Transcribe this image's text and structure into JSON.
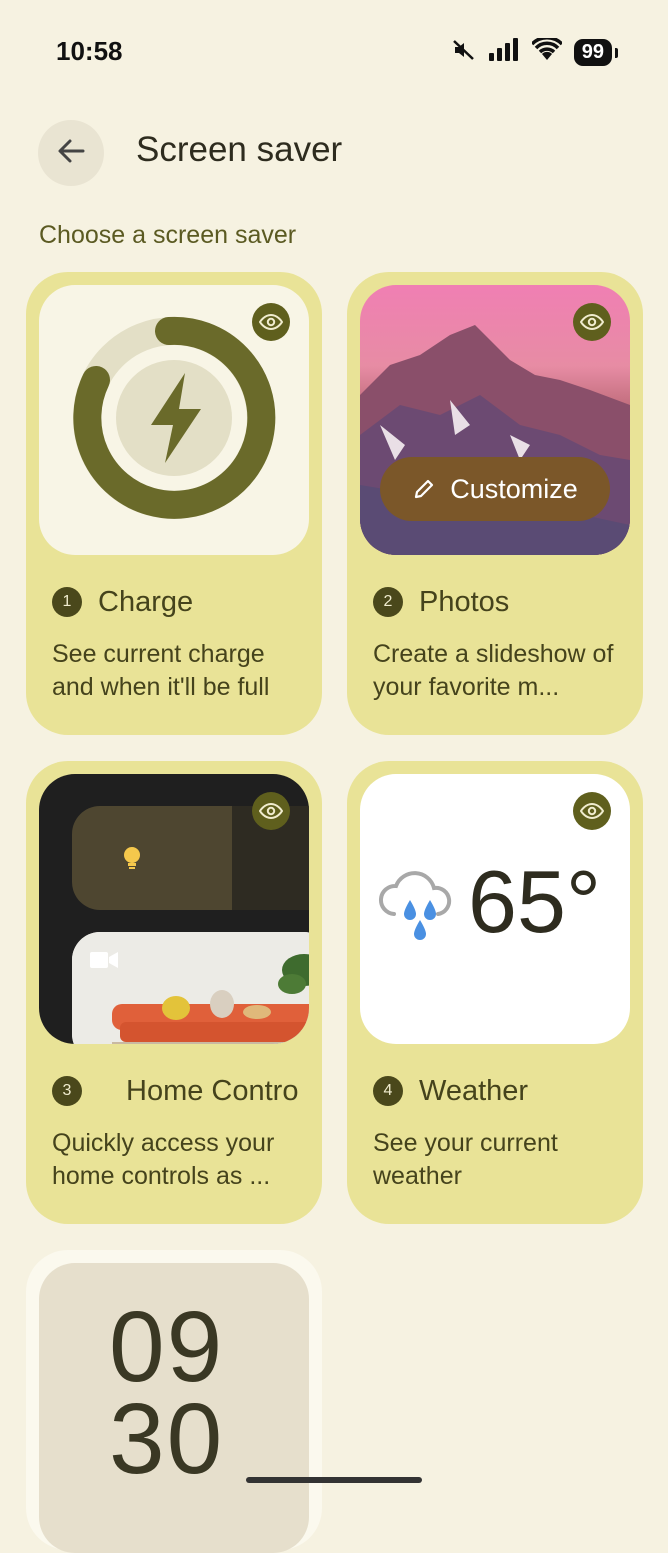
{
  "status_bar": {
    "time": "10:58",
    "battery": "99"
  },
  "header": {
    "title": "Screen saver"
  },
  "section_label": "Choose a screen saver",
  "cards": [
    {
      "number": "1",
      "name": "Charge",
      "description": "See current charge and when it'll be full"
    },
    {
      "number": "2",
      "name": "Photos",
      "description": "Create a slideshow of your favorite m...",
      "action_label": "Customize"
    },
    {
      "number": "3",
      "name": "Home Contro",
      "description": "Quickly access your home controls as ..."
    },
    {
      "number": "4",
      "name": "Weather",
      "description": "See your current weather",
      "temperature": "65°"
    }
  ],
  "clock_preview": {
    "hours": "09",
    "minutes": "30"
  },
  "colors": {
    "background": "#f6f2e1",
    "card": "#e9e397",
    "accent": "#5f5f1d",
    "customize_button": "#7b5729"
  }
}
